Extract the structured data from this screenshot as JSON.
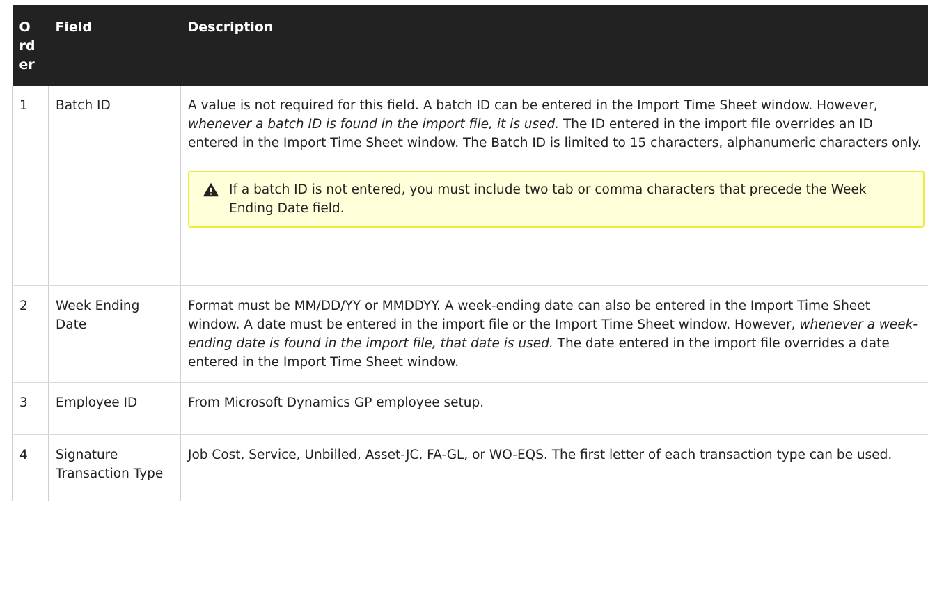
{
  "headers": {
    "order": "O rd er",
    "order_lines": [
      "O",
      "rd",
      "er"
    ],
    "field": "Field",
    "description": "Description"
  },
  "rows": [
    {
      "order": "1",
      "field": "Batch ID",
      "desc_part1": "A value is not required for this field. A batch ID can be entered in the Import Time Sheet window. However, ",
      "desc_em": "whenever a batch ID is found in the import file, it is used.",
      "desc_part2": " The ID entered in the import file overrides an ID entered in the Import Time Sheet window. The Batch ID is limited to 15 characters, alphanumeric characters only.",
      "note": "If a batch ID is not entered, you must include two tab or comma characters that precede the Week Ending Date field.",
      "note_icon": "warning-icon"
    },
    {
      "order": "2",
      "field": "Week Ending Date",
      "desc_part1": "Format must be MM/DD/YY or MMDDYY. A week-ending date can also be entered in the Import Time Sheet window. A date must be entered in the import file or the Import Time Sheet window. However, ",
      "desc_em": "whenever a week-ending date is found in the import file, that date is used.",
      "desc_part2": " The date entered in the import file overrides a date entered in the Import Time Sheet window."
    },
    {
      "order": "3",
      "field": "Employee ID",
      "desc": "From Microsoft Dynamics GP employee setup."
    },
    {
      "order": "4",
      "field": "Signature Transaction Type",
      "desc": "Job Cost, Service, Unbilled, Asset-JC, FA-GL, or WO-EQS. The first letter of each transaction type can be used."
    }
  ],
  "colors": {
    "header_bg": "#222222",
    "header_text": "#ffffff",
    "note_bg": "#ffffd9",
    "note_border": "#efea3f"
  }
}
